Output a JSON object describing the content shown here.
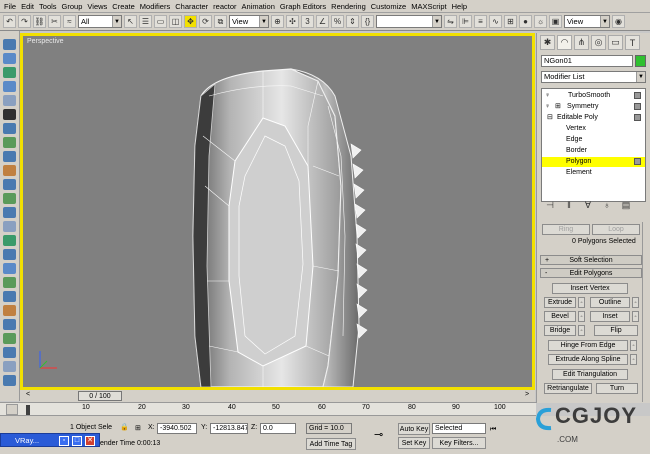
{
  "menu": [
    "File",
    "Edit",
    "Tools",
    "Group",
    "Views",
    "Create",
    "Modifiers",
    "Character",
    "reactor",
    "Animation",
    "Graph Editors",
    "Rendering",
    "Customize",
    "MAXScript",
    "Help"
  ],
  "toolbar": {
    "filter_value": "All",
    "refcoord_value": "View",
    "view_right": "View"
  },
  "viewport": {
    "label": "Perspective",
    "frame_color": "#f2e000",
    "bg_color": "#808080"
  },
  "command_panel": {
    "object_name": "NGon01",
    "object_color": "#30c030",
    "modifier_list_label": "Modifier List",
    "stack": [
      {
        "label": "TurboSmooth",
        "level": 0
      },
      {
        "label": "Symmetry",
        "level": 0
      },
      {
        "label": "Editable Poly",
        "level": 0
      },
      {
        "label": "Vertex",
        "level": 1
      },
      {
        "label": "Edge",
        "level": 1
      },
      {
        "label": "Border",
        "level": 1
      },
      {
        "label": "Polygon",
        "level": 1,
        "selected": true
      },
      {
        "label": "Element",
        "level": 1
      }
    ],
    "ring_label": "Ring",
    "loop_label": "Loop",
    "selection_status": "0 Polygons Selected",
    "soft_selection_header": "Soft Selection",
    "soft_selection_sign": "+",
    "edit_polygons_header": "Edit Polygons",
    "edit_polygons_sign": "-",
    "insert_vertex": "Insert Vertex",
    "extrude": "Extrude",
    "outline": "Outline",
    "bevel": "Bevel",
    "inset": "Inset",
    "bridge": "Bridge",
    "flip": "Flip",
    "hinge_from_edge": "Hinge From Edge",
    "extrude_along_spline": "Extrude Along Spline",
    "edit_triangulation": "Edit Triangulation",
    "retriangulate": "Retriangulate",
    "turn": "Turn",
    "selection_highlight": "#ffff00"
  },
  "timeline": {
    "slider_label": "0 / 100",
    "ticks": [
      "10",
      "20",
      "30",
      "40",
      "50",
      "60",
      "70",
      "80",
      "90",
      "100"
    ]
  },
  "status": {
    "object_sel": "1 Object Sele",
    "x_label": "X:",
    "x_value": "-3940.502",
    "y_label": "Y:",
    "y_value": "-12813.847",
    "z_label": "Z:",
    "z_value": "0.0",
    "grid": "Grid = 10.0",
    "auto_key": "Auto Key",
    "selected_value": "Selected",
    "set_key": "Set Key",
    "key_filters": "Key Filters...",
    "add_time_tag": "Add Time Tag",
    "render_time": "ender Time 0:00:13"
  },
  "taskbar": {
    "title": "VRay..."
  },
  "watermark": {
    "brand": "CGJOY",
    "sub": ".COM"
  }
}
